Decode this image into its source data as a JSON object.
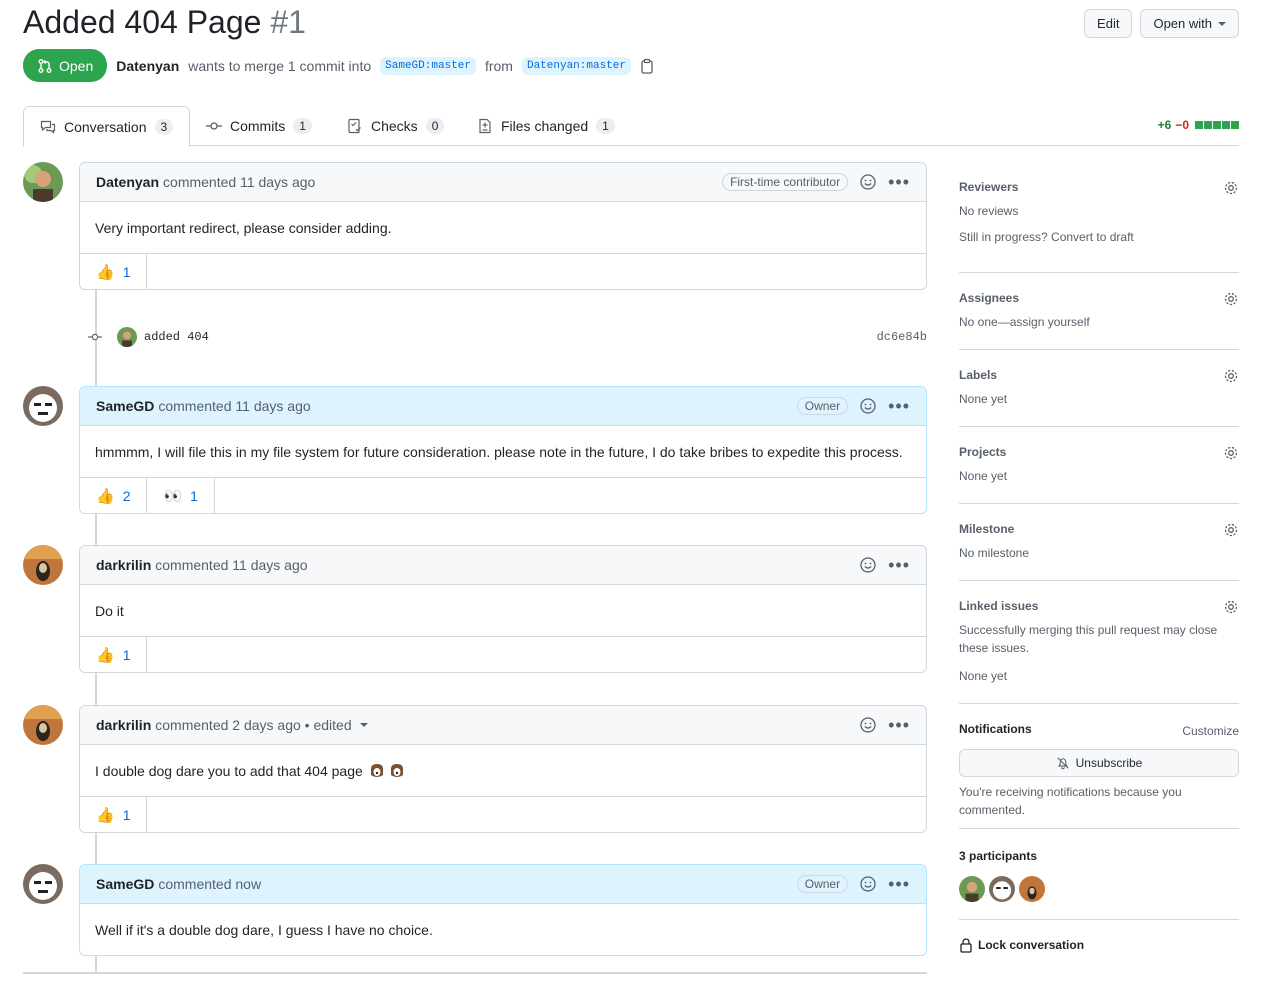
{
  "header": {
    "title": "Added 404 Page",
    "number": "#1",
    "edit_label": "Edit",
    "open_with_label": "Open with"
  },
  "state": {
    "label": "Open",
    "author": "Datenyan",
    "text": "wants to merge 1 commit into",
    "base_branch": "SameGD:master",
    "from_text": "from",
    "head_branch": "Datenyan:master"
  },
  "tabs": [
    {
      "label": "Conversation",
      "count": "3"
    },
    {
      "label": "Commits",
      "count": "1"
    },
    {
      "label": "Checks",
      "count": "0"
    },
    {
      "label": "Files changed",
      "count": "1"
    }
  ],
  "diffstat": {
    "additions": "+6",
    "deletions": "−0"
  },
  "comments": [
    {
      "author": "Datenyan",
      "meta": "commented 11 days ago",
      "role": "First-time contributor",
      "body": "Very important redirect, please consider adding.",
      "reactions": [
        {
          "emoji": "👍",
          "count": "1"
        }
      ]
    },
    {
      "author": "SameGD",
      "meta": "commented 11 days ago",
      "role": "Owner",
      "body": "hmmmm, I will file this in my file system for future consideration. please note in the future, I do take bribes to expedite this process.",
      "reactions": [
        {
          "emoji": "👍",
          "count": "2"
        },
        {
          "emoji": "👀",
          "count": "1"
        }
      ]
    },
    {
      "author": "darkrilin",
      "meta": "commented 11 days ago",
      "role": "",
      "body": "Do it",
      "reactions": [
        {
          "emoji": "👍",
          "count": "1"
        }
      ]
    },
    {
      "author": "darkrilin",
      "meta": "commented 2 days ago • edited",
      "role": "",
      "body": "I double dog dare you to add that 404 page",
      "reactions": [
        {
          "emoji": "👍",
          "count": "1"
        }
      ]
    },
    {
      "author": "SameGD",
      "meta": "commented now",
      "role": "Owner",
      "body": "Well if it's a double dog dare, I guess I have no choice.",
      "reactions": []
    }
  ],
  "commit": {
    "message": "added 404",
    "sha": "dc6e84b"
  },
  "sidebar": {
    "reviewers": {
      "title": "Reviewers",
      "value": "No reviews",
      "extra": "Still in progress? Convert to draft"
    },
    "assignees": {
      "title": "Assignees",
      "value": "No one—assign yourself"
    },
    "labels": {
      "title": "Labels",
      "value": "None yet"
    },
    "projects": {
      "title": "Projects",
      "value": "None yet"
    },
    "milestone": {
      "title": "Milestone",
      "value": "No milestone"
    },
    "linked_issues": {
      "title": "Linked issues",
      "desc": "Successfully merging this pull request may close these issues.",
      "value": "None yet"
    },
    "notifications": {
      "title": "Notifications",
      "customize": "Customize",
      "button": "Unsubscribe",
      "desc": "You're receiving notifications because you commented."
    },
    "participants": {
      "title": "3 participants"
    },
    "lock": "Lock conversation"
  },
  "colors": {
    "open_green": "#2da44e",
    "link_blue": "#0969da",
    "owner_header": "#ddf4ff"
  }
}
